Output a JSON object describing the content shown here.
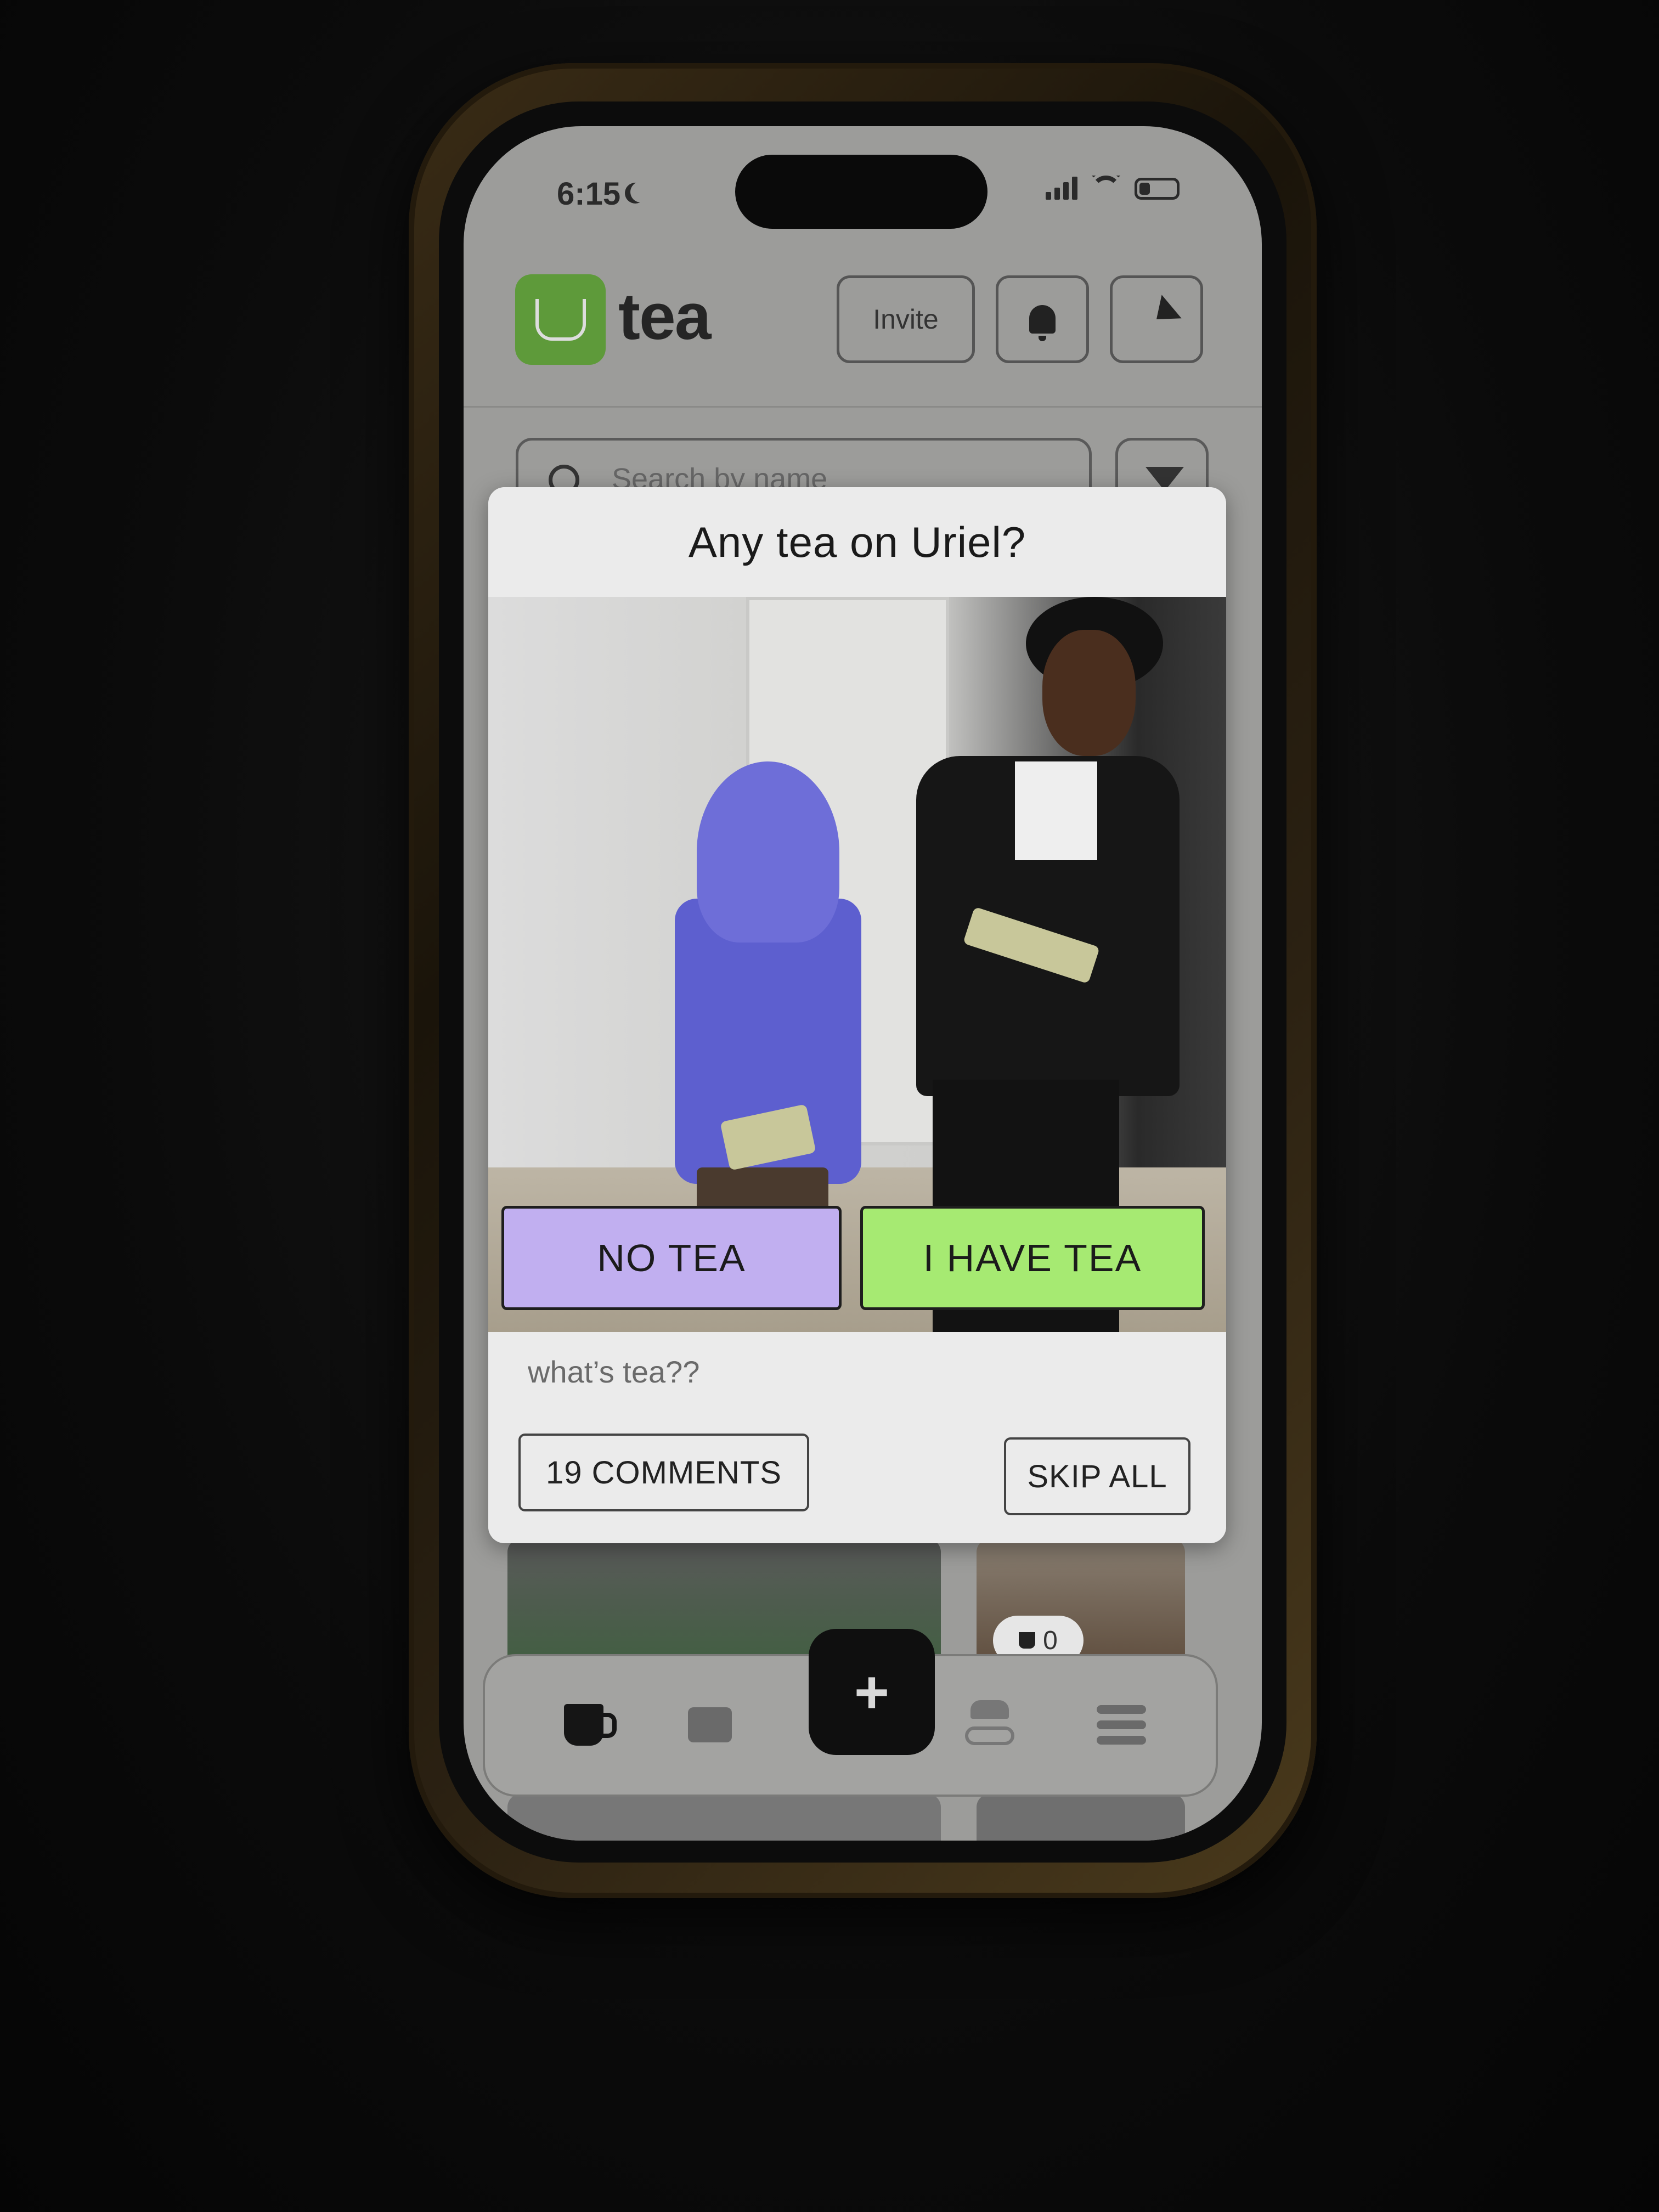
{
  "status_bar": {
    "time": "6:15",
    "battery_level": 0.3
  },
  "app": {
    "name": "tea",
    "invite_label": "Invite",
    "search_placeholder": "Search by name"
  },
  "modal": {
    "title": "Any tea on Uriel?",
    "no_tea_label": "NO TEA",
    "have_tea_label": "I HAVE TEA",
    "whats_tea_link": "what’s tea??",
    "comments_label": "19 COMMENTS",
    "skip_label": "SKIP ALL"
  },
  "grid": {
    "tile_tea_count": "0"
  },
  "nav": {
    "plus_label": "+"
  },
  "colors": {
    "no_tea": "#c1aff0",
    "have_tea": "#a6ea72",
    "logo_green": "#5e9a3a"
  },
  "icons": [
    "moon-icon",
    "signal-icon",
    "wifi-icon",
    "battery-icon",
    "bell-icon",
    "send-icon",
    "search-icon",
    "filter-icon",
    "tea-cup-icon",
    "chat-icon",
    "spy-icon",
    "menu-icon",
    "plus-icon"
  ]
}
